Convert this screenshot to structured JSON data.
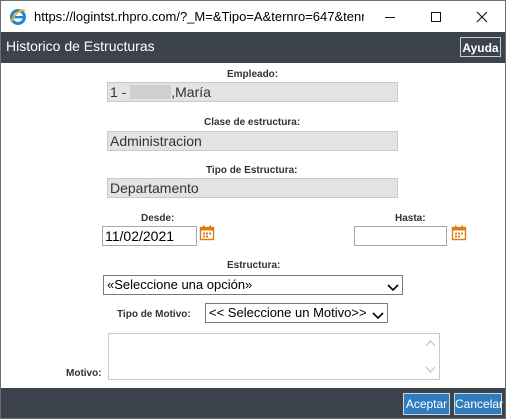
{
  "window": {
    "url": "https://logintst.rhpro.com/?_M=&Tipo=A&ternro=647&tenr..."
  },
  "header": {
    "title": "Historico de Estructuras",
    "help_label": "Ayuda"
  },
  "form": {
    "empleado": {
      "label": "Empleado:",
      "prefix": "1 -",
      "name": ",María"
    },
    "clase": {
      "label": "Clase de estructura:",
      "value": "Administracion"
    },
    "tipo_estructura": {
      "label": "Tipo de Estructura:",
      "value": "Departamento"
    },
    "desde": {
      "label": "Desde:",
      "value": "11/02/2021"
    },
    "hasta": {
      "label": "Hasta:",
      "value": ""
    },
    "estructura": {
      "label": "Estructura:",
      "selected": "«Seleccione una opción»"
    },
    "tipo_motivo": {
      "label": "Tipo de Motivo:",
      "selected": "<< Seleccione un Motivo>>"
    },
    "motivo": {
      "label": "Motivo:",
      "value": ""
    }
  },
  "footer": {
    "accept_label": "Aceptar",
    "cancel_label": "Cancelar"
  },
  "colors": {
    "header_bg": "#3d434c",
    "button_bg": "#2f7cbf",
    "calendar_icon": "#e07b12"
  },
  "icons": [
    "ie-icon",
    "minimize-icon",
    "maximize-icon",
    "close-icon",
    "calendar-icon",
    "chevron-down-icon"
  ]
}
